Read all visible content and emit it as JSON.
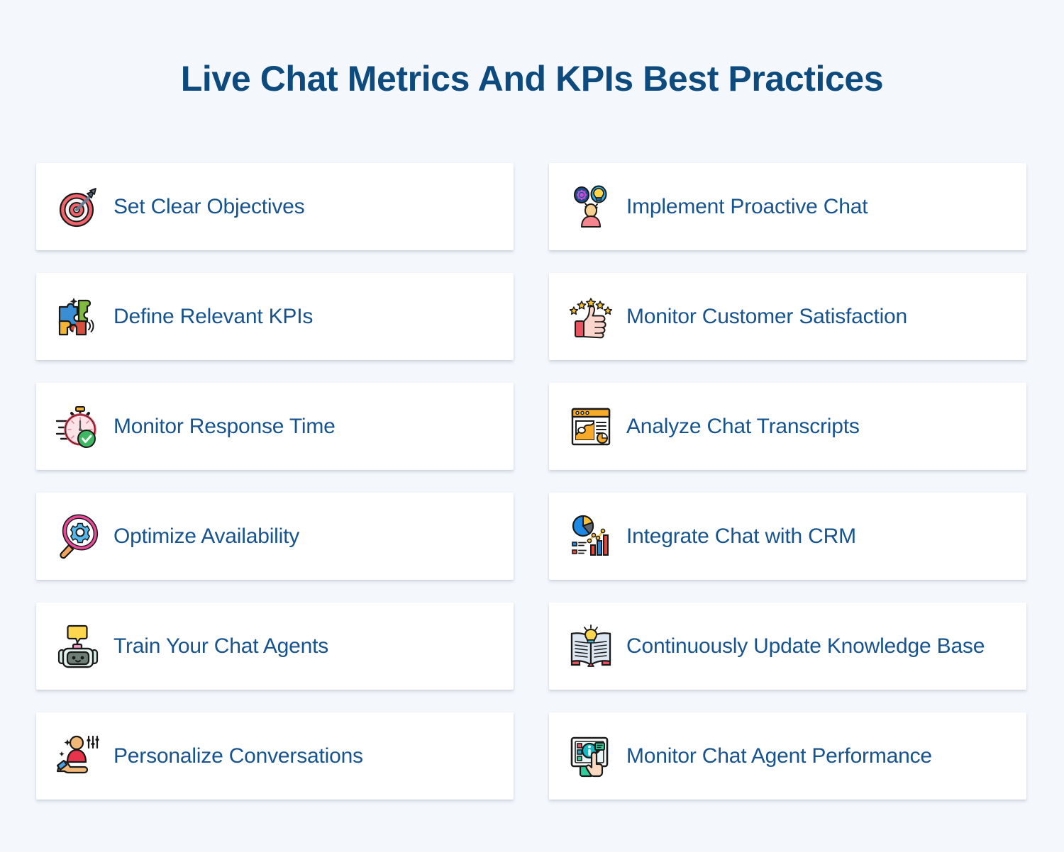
{
  "header": {
    "title": "Live Chat Metrics And KPIs Best Practices"
  },
  "theme": {
    "background": "#f4f7fc",
    "card_background": "#ffffff",
    "title_color": "#0d4a7d",
    "label_color": "#17548f"
  },
  "cards": [
    {
      "label": "Set Clear Objectives",
      "icon": "target-arrow-icon",
      "column": "left"
    },
    {
      "label": "Implement Proactive Chat",
      "icon": "person-ideas-icon",
      "column": "right"
    },
    {
      "label": "Define Relevant KPIs",
      "icon": "puzzle-pieces-icon",
      "column": "left"
    },
    {
      "label": "Monitor Customer Satisfaction",
      "icon": "thumbs-up-stars-icon",
      "column": "right"
    },
    {
      "label": "Monitor Response Time",
      "icon": "stopwatch-check-icon",
      "column": "left"
    },
    {
      "label": "Analyze Chat Transcripts",
      "icon": "browser-analytics-icon",
      "column": "right"
    },
    {
      "label": "Optimize Availability",
      "icon": "magnifier-gear-icon",
      "column": "left"
    },
    {
      "label": "Integrate Chat with CRM",
      "icon": "charts-dashboard-icon",
      "column": "right"
    },
    {
      "label": "Train Your Chat Agents",
      "icon": "chatbot-robot-icon",
      "column": "left"
    },
    {
      "label": "Continuously Update Knowledge Base",
      "icon": "book-lightbulb-icon",
      "column": "right"
    },
    {
      "label": "Personalize Conversations",
      "icon": "hand-person-sliders-icon",
      "column": "left"
    },
    {
      "label": "Monitor Chat Agent Performance",
      "icon": "monitor-hand-info-icon",
      "column": "right"
    }
  ]
}
